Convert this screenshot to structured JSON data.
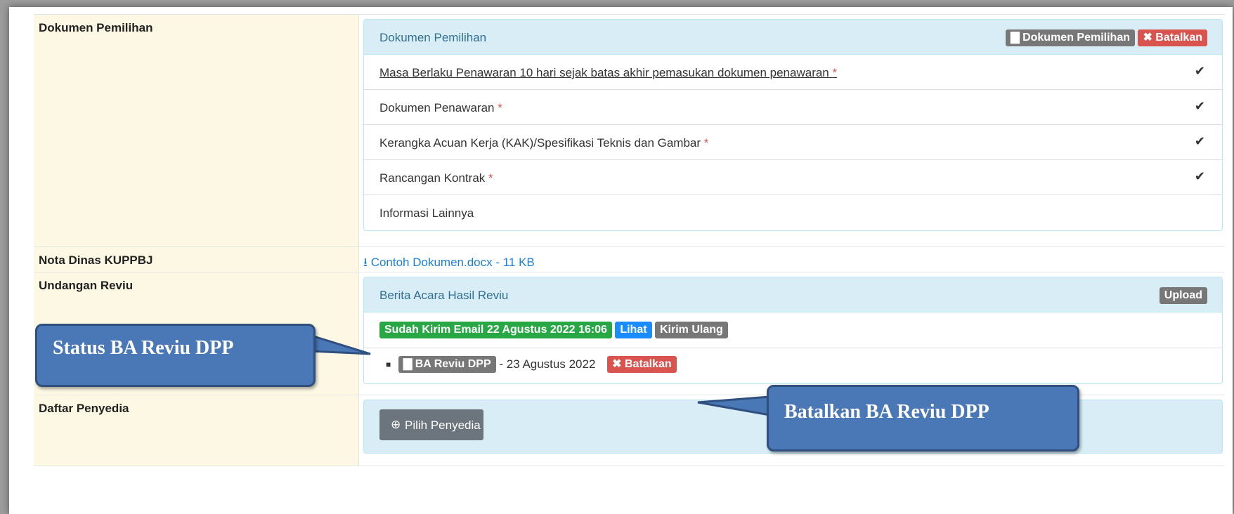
{
  "rows": {
    "dokumen": {
      "label": "Dokumen Pemilihan",
      "panel_title": "Dokumen Pemilihan",
      "btn_dokumen": "Dokumen Pemilihan",
      "btn_batalkan": "Batalkan",
      "items": [
        {
          "text": "Masa Berlaku Penawaran 10 hari sejak batas akhir pemasukan dokumen penawaran",
          "required": "*",
          "checked": true
        },
        {
          "text": "Dokumen Penawaran",
          "required": "*",
          "checked": true
        },
        {
          "text": "Kerangka Acuan Kerja (KAK)/Spesifikasi Teknis dan Gambar",
          "required": "*",
          "checked": true
        },
        {
          "text": "Rancangan Kontrak",
          "required": "*",
          "checked": true
        },
        {
          "text": "Informasi Lainnya",
          "required": "",
          "checked": false
        }
      ]
    },
    "nota": {
      "label": "Nota Dinas KUPPBJ",
      "file_link": "Contoh Dokumen.docx - 11 KB"
    },
    "undangan": {
      "label": "Undangan Reviu",
      "panel_title": "Berita Acara Hasil Reviu",
      "upload": "Upload",
      "status": "Sudah Kirim Email 22 Agustus 2022 16:06",
      "lihat": "Lihat",
      "kirim_ulang": "Kirim Ulang",
      "ba_file": "BA Reviu DPP",
      "ba_date": "- 23 Agustus 2022",
      "ba_batalkan": "Batalkan"
    },
    "penyedia": {
      "label": "Daftar Penyedia",
      "button": "Pilih Penyedia"
    }
  },
  "callouts": {
    "status": "Status BA Reviu DPP",
    "batalkan": "Batalkan BA Reviu DPP"
  },
  "colors": {
    "label_bg": "#fcf8e3",
    "panel_head_bg": "#d9edf7",
    "callout_bg": "#4a78b7",
    "danger": "#d9534f",
    "success": "#28a745",
    "primary": "#1a8cff"
  }
}
